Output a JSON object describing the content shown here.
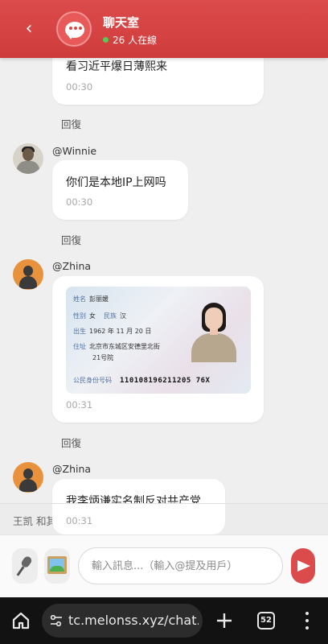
{
  "header": {
    "title": "聊天室",
    "online": "26 人在線"
  },
  "messages": [
    {
      "text": "看习近平爆日薄熙来",
      "time": "00:30",
      "reply": "回復"
    },
    {
      "user": "@Winnie",
      "text": "你们是本地IP上网吗",
      "time": "00:30",
      "reply": "回復"
    },
    {
      "user": "@Zhina",
      "image": {
        "name_label": "姓名",
        "name": "彭丽媛",
        "sex_label": "性别",
        "sex": "女",
        "ethnic_label": "民族",
        "ethnic": "汉",
        "birth_label": "出生",
        "birth": "1962 年 11 月 20 日",
        "address_label": "住址",
        "address_line1": "北京市东城区安德里北街",
        "address_line2": "21号院",
        "id_label": "公民身份号码",
        "id_number": "110108196211205 76X"
      },
      "time": "00:31",
      "reply": "回復"
    },
    {
      "user": "@Zhina",
      "text": "我李炳谦实名制反对共产党",
      "time": "00:31"
    }
  ],
  "typing": "王凯 和其",
  "composer": {
    "placeholder": "輸入訊息...（輸入@提及用戶）"
  },
  "browser": {
    "url": "tc.melonss.xyz/chat.",
    "tab_count": "52"
  },
  "colors": {
    "header": "#d94545",
    "send": "#dc4b4b",
    "online_dot": "#5ac85a"
  }
}
